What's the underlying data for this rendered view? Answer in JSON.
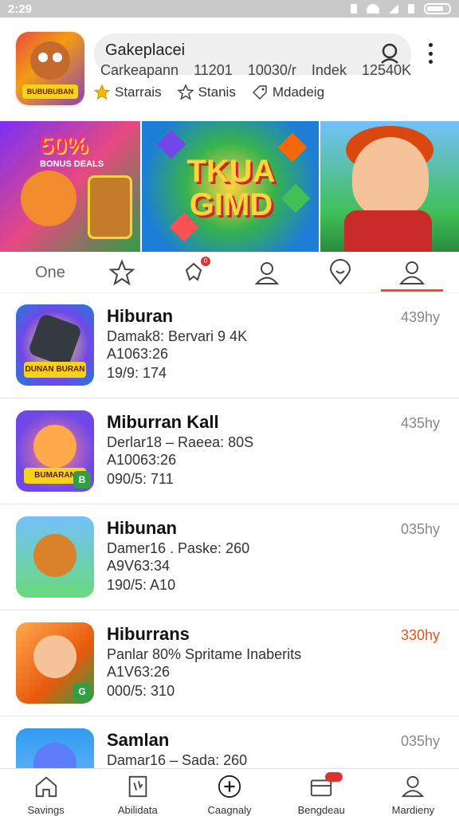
{
  "status_bar": {
    "time": "2:29"
  },
  "header": {
    "app_icon_tag": "BUBUBUBAN",
    "search_title": "Gakeplacei",
    "subline": [
      "Carkeapann",
      "11201",
      "10030/r",
      "Indek",
      "12540K"
    ],
    "chips": [
      {
        "icon": "star-filled-icon",
        "label": "Starrais"
      },
      {
        "icon": "star-outline-icon",
        "label": "Stanis"
      },
      {
        "icon": "tag-icon",
        "label": "Mdadeig"
      }
    ]
  },
  "banner": {
    "panel1_text": "50%",
    "panel1_small": "BONUS DEALS",
    "panel2_text": "TKUA GIMD"
  },
  "tabs": {
    "first_label": "One",
    "items": [
      "star-icon",
      "notification-icon",
      "person-icon",
      "location-icon",
      "profile-icon"
    ],
    "badge": "0",
    "active_index": 5,
    "accent": "#e8541e"
  },
  "list": [
    {
      "title": "Hiburan",
      "line1": "Damak8:  Bervari  9 4K",
      "line2": "A1063:26",
      "line3": "19/9:  174",
      "time": "439hy",
      "accent": false,
      "thumb_label": "DUNAN BURAN",
      "badge": ""
    },
    {
      "title": "Miburran Kall",
      "line1": "Derlar18 – Raeea: 80S",
      "line2": "A10063:26",
      "line3": "090/5:  711",
      "time": "435hy",
      "accent": false,
      "thumb_label": "BUMARAN",
      "badge": "B"
    },
    {
      "title": "Hibunan",
      "line1": "Damer16 .  Paske:  260",
      "line2": "A9V63:34",
      "line3": "190/5:  A10",
      "time": "035hy",
      "accent": false,
      "thumb_label": "",
      "badge": ""
    },
    {
      "title": "Hiburrans",
      "line1": "Panlar  80%  Spritame  Inaberits",
      "line2": "A1V63:26",
      "line3": "000/5:  310",
      "time": "330hy",
      "accent": true,
      "thumb_label": "",
      "badge": "G"
    },
    {
      "title": "Samlan",
      "line1": "Damar16 –  Sada:  260",
      "line2": "",
      "line3": "",
      "time": "035hy",
      "accent": false,
      "thumb_label": "",
      "badge": ""
    }
  ],
  "bottom_nav": [
    {
      "icon": "home-icon",
      "label": "Savings"
    },
    {
      "icon": "document-icon",
      "label": "Abilidata"
    },
    {
      "icon": "plus-circle-icon",
      "label": "Caagnaly"
    },
    {
      "icon": "briefcase-icon",
      "label": "Bengdeau"
    },
    {
      "icon": "person-icon",
      "label": "Mardieny"
    }
  ]
}
